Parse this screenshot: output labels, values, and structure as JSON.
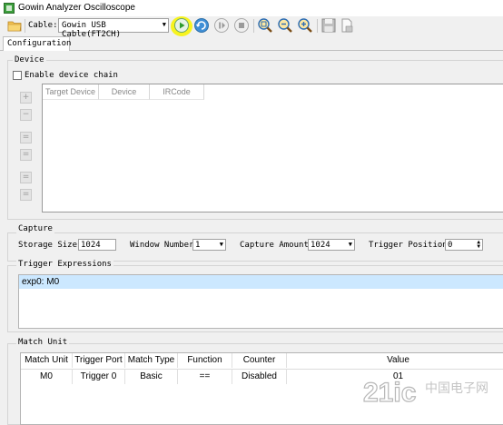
{
  "window": {
    "title": "Gowin Analyzer Oscilloscope"
  },
  "toolbar": {
    "cable_label": "Cable:",
    "cable_value": "Gowin USB Cable(FT2CH)",
    "buttons": [
      "open-icon",
      "run-icon",
      "refresh-icon",
      "pause-icon",
      "stop-icon",
      "zoom-fit-icon",
      "zoom-out-icon",
      "zoom-in-icon",
      "save-icon",
      "export-icon"
    ]
  },
  "tabs": [
    {
      "label": "Configuration"
    }
  ],
  "device": {
    "group_label": "Device",
    "chain_checkbox_label": "Enable device chain",
    "chain_checked": false,
    "table_headers": [
      "Target Device",
      "Device",
      "IRCode"
    ],
    "side_buttons": [
      "+",
      "−",
      "=",
      "=",
      "=",
      "="
    ]
  },
  "capture": {
    "group_label": "Capture",
    "storage_size_label": "Storage Size:",
    "storage_size_value": "1024",
    "window_number_label": "Window Number:",
    "window_number_value": "1",
    "capture_amount_label": "Capture Amount:",
    "capture_amount_value": "1024",
    "trigger_position_label": "Trigger Position:",
    "trigger_position_value": "0"
  },
  "trigger": {
    "group_label": "Trigger Expressions",
    "expressions": [
      "exp0: M0"
    ]
  },
  "match_unit": {
    "group_label": "Match Unit",
    "headers": [
      "Match Unit",
      "Trigger Port",
      "Match Type",
      "Function",
      "Counter",
      "Value"
    ],
    "rows": [
      [
        "M0",
        "Trigger 0",
        "Basic",
        "==",
        "Disabled",
        "01"
      ]
    ]
  },
  "watermark": {
    "text": "21ic中国电子网"
  },
  "colors": {
    "accent_selection": "#cce8ff",
    "run_highlight": "#f7f31f"
  }
}
